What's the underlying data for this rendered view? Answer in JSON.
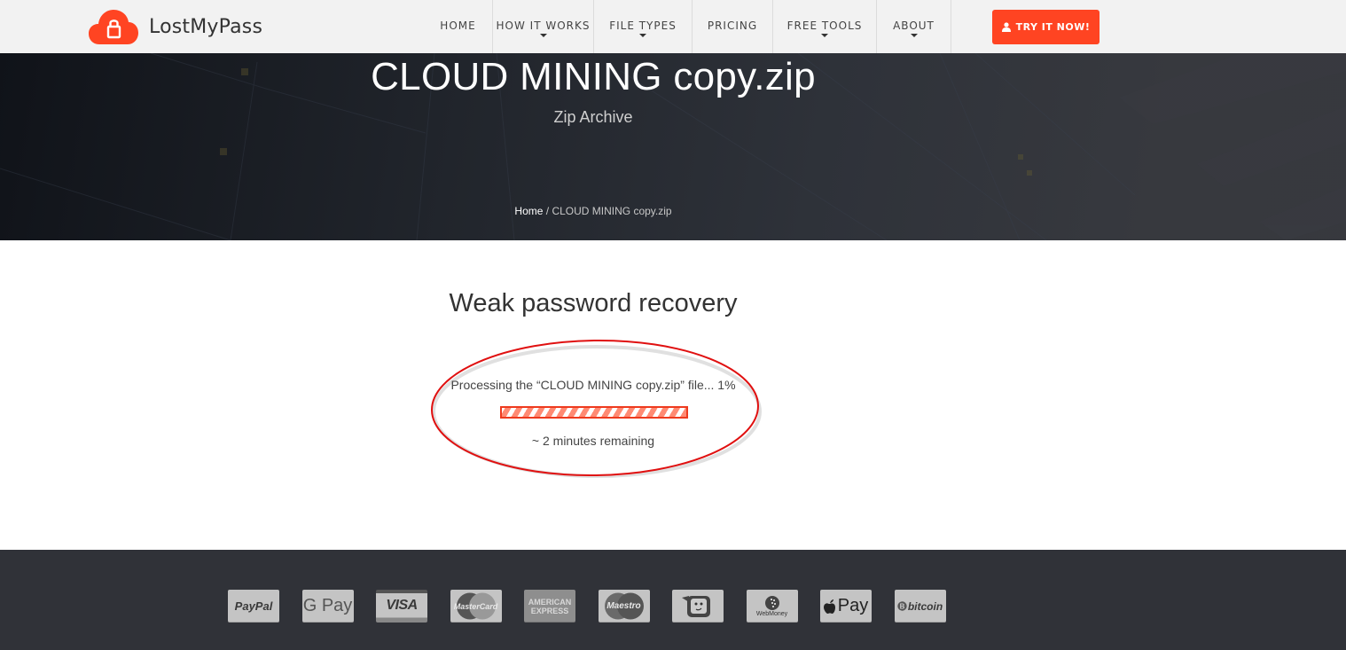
{
  "header": {
    "logo_text": "LostMyPass",
    "logo_icon": "cloud-lock-icon",
    "nav": [
      {
        "label": "HOME",
        "has_dropdown": false
      },
      {
        "label": "HOW IT WORKS",
        "has_dropdown": true
      },
      {
        "label": "FILE TYPES",
        "has_dropdown": true
      },
      {
        "label": "PRICING",
        "has_dropdown": false
      },
      {
        "label": "FREE TOOLS",
        "has_dropdown": true
      },
      {
        "label": "ABOUT",
        "has_dropdown": true
      }
    ],
    "cta_label": "TRY IT NOW!",
    "cta_icon": "user-icon",
    "accent_color": "#ff4422"
  },
  "hero": {
    "title": "CLOUD MINING copy.zip",
    "subtitle": "Zip Archive",
    "breadcrumb": {
      "home": "Home",
      "separator": " / ",
      "current": "CLOUD MINING copy.zip"
    }
  },
  "main": {
    "title": "Weak password recovery",
    "processing_text": "Processing the “CLOUD MINING copy.zip” file... 1%",
    "progress_percent": 1,
    "remaining_text": "~ 2 minutes remaining",
    "annotation": "red-ellipse-highlight"
  },
  "footer": {
    "payment_methods": [
      {
        "name": "PayPal",
        "label": "PayPal"
      },
      {
        "name": "Google Pay",
        "label": "G Pay"
      },
      {
        "name": "Visa",
        "label": "VISA"
      },
      {
        "name": "MasterCard",
        "label": "MasterCard"
      },
      {
        "name": "American Express",
        "label": "AMERICAN EXPRESS"
      },
      {
        "name": "Maestro",
        "label": "Maestro"
      },
      {
        "name": "Qiwi",
        "label": ""
      },
      {
        "name": "WebMoney",
        "label": "WebMoney"
      },
      {
        "name": "Apple Pay",
        "label": "Pay"
      },
      {
        "name": "Bitcoin",
        "label": "bitcoin"
      }
    ]
  }
}
